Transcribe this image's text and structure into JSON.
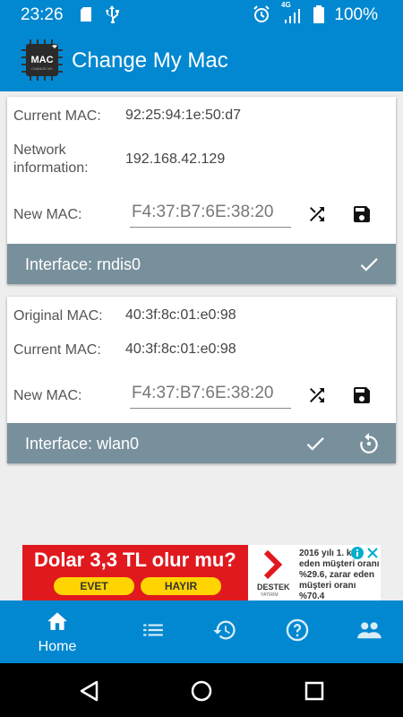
{
  "status_bar": {
    "time": "23:26",
    "network_type": "4G",
    "battery_percent": "100%",
    "icons": [
      "sd-card-icon",
      "usb-icon",
      "alarm-icon",
      "signal-icon",
      "battery-icon"
    ]
  },
  "app_bar": {
    "title": "Change My Mac",
    "logo_text": "MAC",
    "logo_subtext": "CHANGE MY"
  },
  "interfaces": [
    {
      "rows": [
        {
          "label": "Current MAC:",
          "value": "92:25:94:1e:50:d7"
        },
        {
          "label": "Network information:",
          "value": "192.168.42.129"
        }
      ],
      "new_mac_label": "New MAC:",
      "new_mac_placeholder": "F4:37:B7:6E:38:20",
      "interface_label": "Interface: rndis0",
      "actions": [
        "shuffle-icon",
        "save-icon",
        "check-icon"
      ]
    },
    {
      "rows": [
        {
          "label": "Original MAC:",
          "value": "40:3f:8c:01:e0:98"
        },
        {
          "label": "Current MAC:",
          "value": "40:3f:8c:01:e0:98"
        }
      ],
      "new_mac_label": "New MAC:",
      "new_mac_placeholder": "F4:37:B7:6E:38:20",
      "interface_label": "Interface: wlan0",
      "actions": [
        "shuffle-icon",
        "save-icon",
        "check-icon",
        "restore-icon"
      ]
    }
  ],
  "ad": {
    "headline": "Dolar 3,3 TL olur mu?",
    "yes_label": "EVET",
    "no_label": "HAYIR",
    "brand": "DESTEK",
    "brand_sub": "YATIRIM",
    "detail": "2016 yılı 1. kar eden müşteri oranı %29.6, zarar eden müşteri oranı %70.4"
  },
  "bottom_nav": {
    "items": [
      {
        "label": "Home",
        "icon": "home-icon",
        "active": true
      },
      {
        "label": "",
        "icon": "list-icon",
        "active": false
      },
      {
        "label": "",
        "icon": "history-icon",
        "active": false
      },
      {
        "label": "",
        "icon": "help-icon",
        "active": false
      },
      {
        "label": "",
        "icon": "people-icon",
        "active": false
      }
    ]
  },
  "system_nav": [
    "back-icon",
    "home-circle-icon",
    "recents-icon"
  ],
  "colors": {
    "primary": "#0288d1",
    "interface_bar": "#78909c",
    "ad_red": "#e0191e",
    "ad_yellow": "#ffd400"
  }
}
